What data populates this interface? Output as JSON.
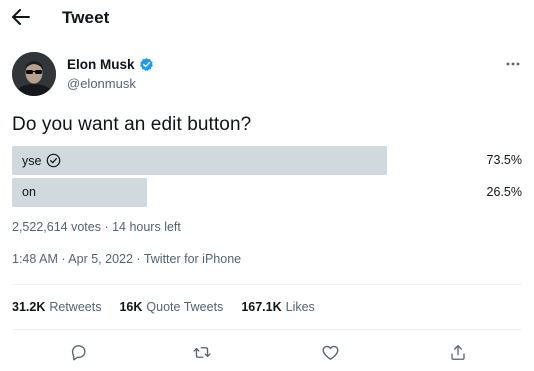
{
  "header": {
    "title": "Tweet"
  },
  "author": {
    "name": "Elon Musk",
    "handle": "@elonmusk"
  },
  "tweet": {
    "text": "Do you want an edit button?"
  },
  "poll": {
    "options": [
      {
        "label": "yse",
        "percent_text": "73.5%",
        "percent": 73.5,
        "winner": true
      },
      {
        "label": "on",
        "percent_text": "26.5%",
        "percent": 26.5,
        "winner": false
      }
    ],
    "votes": "2,522,614 votes",
    "separator": " · ",
    "time_left": "14 hours left"
  },
  "meta": {
    "time": "1:48 AM",
    "separator": " · ",
    "date": "Apr 5, 2022",
    "separator2": " · ",
    "source": "Twitter for iPhone"
  },
  "stats": {
    "retweets_count": "31.2K",
    "retweets_label": "Retweets",
    "quotes_count": "16K",
    "quotes_label": "Quote Tweets",
    "likes_count": "167.1K",
    "likes_label": "Likes"
  },
  "colors": {
    "bar": "#cfd9de",
    "verified": "#1d9bf0",
    "secondary_text": "#536471",
    "primary_text": "#0f1419"
  },
  "icons": {
    "back": "arrow-left-icon",
    "verified": "verified-badge-icon",
    "more": "more-dots-icon",
    "check": "check-circle-icon",
    "reply": "reply-icon",
    "retweet": "retweet-icon",
    "like": "heart-icon",
    "share": "share-icon"
  }
}
